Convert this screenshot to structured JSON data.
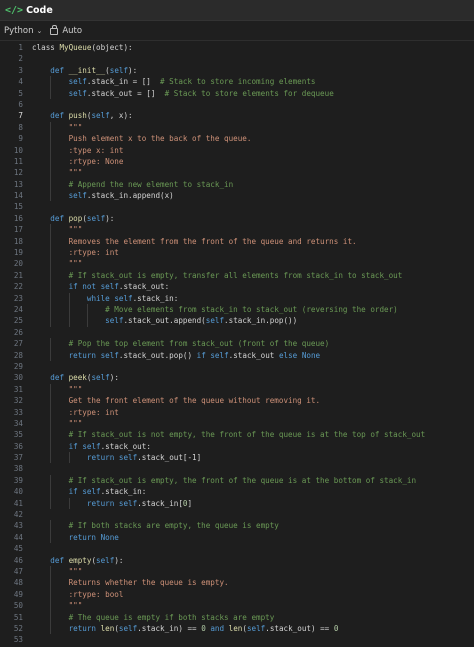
{
  "header": {
    "icon": "code-icon",
    "title": "Code"
  },
  "toolbar": {
    "language": "Python",
    "mode": "Auto"
  },
  "editor": {
    "active_line": 7,
    "lines": [
      [
        [
          "",
          "class "
        ],
        [
          "fn",
          "MyQueue"
        ],
        [
          "",
          "(object):"
        ]
      ],
      [],
      [
        [
          "",
          "    "
        ],
        [
          "kw",
          "def"
        ],
        [
          "",
          " "
        ],
        [
          "fn",
          "__init__"
        ],
        [
          "",
          "("
        ],
        [
          "slf",
          "self"
        ],
        [
          "",
          "):"
        ]
      ],
      [
        [
          "",
          "        "
        ],
        [
          "slf",
          "self"
        ],
        [
          "",
          ".stack_in = []  "
        ],
        [
          "cm",
          "# Stack to store incoming elements"
        ]
      ],
      [
        [
          "",
          "        "
        ],
        [
          "slf",
          "self"
        ],
        [
          "",
          ".stack_out = []  "
        ],
        [
          "cm",
          "# Stack to store elements for dequeue"
        ]
      ],
      [],
      [
        [
          "",
          "    "
        ],
        [
          "kw",
          "def"
        ],
        [
          "",
          " "
        ],
        [
          "fn",
          "push"
        ],
        [
          "",
          "("
        ],
        [
          "slf",
          "self"
        ],
        [
          "",
          ", x):"
        ]
      ],
      [
        [
          "",
          "        "
        ],
        [
          "st",
          "\"\"\""
        ]
      ],
      [
        [
          "",
          "        "
        ],
        [
          "st",
          "Push element x to the back of the queue."
        ]
      ],
      [
        [
          "",
          "        "
        ],
        [
          "st",
          ":type x: int"
        ]
      ],
      [
        [
          "",
          "        "
        ],
        [
          "st",
          ":rtype: None"
        ]
      ],
      [
        [
          "",
          "        "
        ],
        [
          "st",
          "\"\"\""
        ]
      ],
      [
        [
          "",
          "        "
        ],
        [
          "cm",
          "# Append the new element to stack_in"
        ]
      ],
      [
        [
          "",
          "        "
        ],
        [
          "slf",
          "self"
        ],
        [
          "",
          ".stack_in.append(x)"
        ]
      ],
      [],
      [
        [
          "",
          "    "
        ],
        [
          "kw",
          "def"
        ],
        [
          "",
          " "
        ],
        [
          "fn",
          "pop"
        ],
        [
          "",
          "("
        ],
        [
          "slf",
          "self"
        ],
        [
          "",
          "):"
        ]
      ],
      [
        [
          "",
          "        "
        ],
        [
          "st",
          "\"\"\""
        ]
      ],
      [
        [
          "",
          "        "
        ],
        [
          "st",
          "Removes the element from the front of the queue and returns it."
        ]
      ],
      [
        [
          "",
          "        "
        ],
        [
          "st",
          ":rtype: int"
        ]
      ],
      [
        [
          "",
          "        "
        ],
        [
          "st",
          "\"\"\""
        ]
      ],
      [
        [
          "",
          "        "
        ],
        [
          "cm",
          "# If stack_out is empty, transfer all elements from stack_in to stack_out"
        ]
      ],
      [
        [
          "",
          "        "
        ],
        [
          "kw",
          "if not"
        ],
        [
          "",
          " "
        ],
        [
          "slf",
          "self"
        ],
        [
          "",
          ".stack_out:"
        ]
      ],
      [
        [
          "",
          "            "
        ],
        [
          "kw",
          "while"
        ],
        [
          "",
          " "
        ],
        [
          "slf",
          "self"
        ],
        [
          "",
          ".stack_in:"
        ]
      ],
      [
        [
          "",
          "                "
        ],
        [
          "cm",
          "# Move elements from stack_in to stack_out (reversing the order)"
        ]
      ],
      [
        [
          "",
          "                "
        ],
        [
          "slf",
          "self"
        ],
        [
          "",
          ".stack_out.append("
        ],
        [
          "slf",
          "self"
        ],
        [
          "",
          ".stack_in.pop())"
        ]
      ],
      [],
      [
        [
          "",
          "        "
        ],
        [
          "cm",
          "# Pop the top element from stack_out (front of the queue)"
        ]
      ],
      [
        [
          "",
          "        "
        ],
        [
          "kw",
          "return"
        ],
        [
          "",
          " "
        ],
        [
          "slf",
          "self"
        ],
        [
          "",
          ".stack_out.pop() "
        ],
        [
          "kw",
          "if"
        ],
        [
          "",
          " "
        ],
        [
          "slf",
          "self"
        ],
        [
          "",
          ".stack_out "
        ],
        [
          "kw",
          "else"
        ],
        [
          "",
          " "
        ],
        [
          "kw",
          "None"
        ]
      ],
      [],
      [
        [
          "",
          "    "
        ],
        [
          "kw",
          "def"
        ],
        [
          "",
          " "
        ],
        [
          "fn",
          "peek"
        ],
        [
          "",
          "("
        ],
        [
          "slf",
          "self"
        ],
        [
          "",
          "):"
        ]
      ],
      [
        [
          "",
          "        "
        ],
        [
          "st",
          "\"\"\""
        ]
      ],
      [
        [
          "",
          "        "
        ],
        [
          "st",
          "Get the front element of the queue without removing it."
        ]
      ],
      [
        [
          "",
          "        "
        ],
        [
          "st",
          ":rtype: int"
        ]
      ],
      [
        [
          "",
          "        "
        ],
        [
          "st",
          "\"\"\""
        ]
      ],
      [
        [
          "",
          "        "
        ],
        [
          "cm",
          "# If stack_out is not empty, the front of the queue is at the top of stack_out"
        ]
      ],
      [
        [
          "",
          "        "
        ],
        [
          "kw",
          "if"
        ],
        [
          "",
          " "
        ],
        [
          "slf",
          "self"
        ],
        [
          "",
          ".stack_out:"
        ]
      ],
      [
        [
          "",
          "            "
        ],
        [
          "kw",
          "return"
        ],
        [
          "",
          " "
        ],
        [
          "slf",
          "self"
        ],
        [
          "",
          ".stack_out[-1]"
        ]
      ],
      [],
      [
        [
          "",
          "        "
        ],
        [
          "cm",
          "# If stack_out is empty, the front of the queue is at the bottom of stack_in"
        ]
      ],
      [
        [
          "",
          "        "
        ],
        [
          "kw",
          "if"
        ],
        [
          "",
          " "
        ],
        [
          "slf",
          "self"
        ],
        [
          "",
          ".stack_in:"
        ]
      ],
      [
        [
          "",
          "            "
        ],
        [
          "kw",
          "return"
        ],
        [
          "",
          " "
        ],
        [
          "slf",
          "self"
        ],
        [
          "",
          ".stack_in["
        ],
        [
          "nm",
          "0"
        ],
        [
          "",
          "]"
        ]
      ],
      [],
      [
        [
          "",
          "        "
        ],
        [
          "cm",
          "# If both stacks are empty, the queue is empty"
        ]
      ],
      [
        [
          "",
          "        "
        ],
        [
          "kw",
          "return"
        ],
        [
          "",
          " "
        ],
        [
          "kw",
          "None"
        ]
      ],
      [],
      [
        [
          "",
          "    "
        ],
        [
          "kw",
          "def"
        ],
        [
          "",
          " "
        ],
        [
          "fn",
          "empty"
        ],
        [
          "",
          "("
        ],
        [
          "slf",
          "self"
        ],
        [
          "",
          "):"
        ]
      ],
      [
        [
          "",
          "        "
        ],
        [
          "st",
          "\"\"\""
        ]
      ],
      [
        [
          "",
          "        "
        ],
        [
          "st",
          "Returns whether the queue is empty."
        ]
      ],
      [
        [
          "",
          "        "
        ],
        [
          "st",
          ":rtype: bool"
        ]
      ],
      [
        [
          "",
          "        "
        ],
        [
          "st",
          "\"\"\""
        ]
      ],
      [
        [
          "",
          "        "
        ],
        [
          "cm",
          "# The queue is empty if both stacks are empty"
        ]
      ],
      [
        [
          "",
          "        "
        ],
        [
          "kw",
          "return"
        ],
        [
          "",
          " "
        ],
        [
          "fn",
          "len"
        ],
        [
          "",
          "("
        ],
        [
          "slf",
          "self"
        ],
        [
          "",
          ".stack_in) == "
        ],
        [
          "nm",
          "0"
        ],
        [
          "",
          " "
        ],
        [
          "kw",
          "and"
        ],
        [
          "",
          " "
        ],
        [
          "fn",
          "len"
        ],
        [
          "",
          "("
        ],
        [
          "slf",
          "self"
        ],
        [
          "",
          ".stack_out) == "
        ],
        [
          "nm",
          "0"
        ]
      ],
      []
    ]
  }
}
